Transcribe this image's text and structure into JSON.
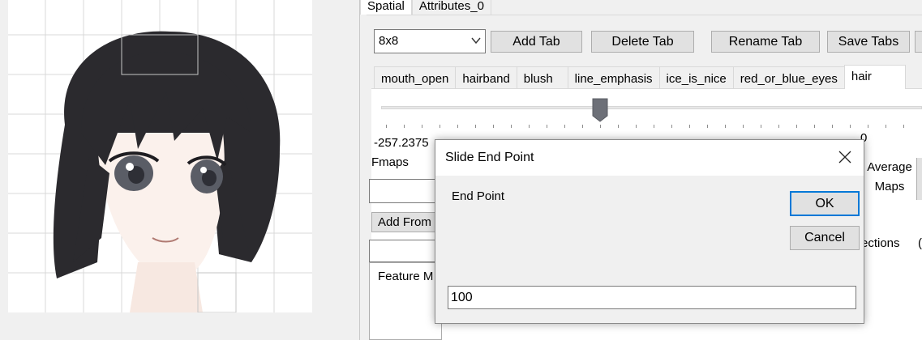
{
  "top_tabs": [
    {
      "label": "Spatial"
    },
    {
      "label": "Attributes_0"
    }
  ],
  "toolbar": {
    "grid_select_value": "8x8",
    "add_tab": "Add Tab",
    "delete_tab": "Delete Tab",
    "rename_tab": "Rename Tab",
    "save_tabs": "Save Tabs"
  },
  "feature_tabs": [
    {
      "label": "mouth_open"
    },
    {
      "label": "hairband"
    },
    {
      "label": "blush"
    },
    {
      "label": "line_emphasis"
    },
    {
      "label": "ice_is_nice"
    },
    {
      "label": "red_or_blue_eyes"
    },
    {
      "label": "hair"
    }
  ],
  "slider": {
    "min_label": "-257.2375",
    "max_label_partial": "0",
    "position_fraction": 0.4
  },
  "panel": {
    "fmaps_label": "Fmaps",
    "add_from_label": "Add From",
    "feature_header": "Feature M",
    "average_maps_line1": "Average",
    "average_maps_line2": "Maps",
    "directions_label": "ections",
    "directions_paren": "("
  },
  "dialog": {
    "title": "Slide End Point",
    "label": "End Point",
    "ok": "OK",
    "cancel": "Cancel",
    "input_value": "100"
  },
  "colors": {
    "accent": "#0078d7",
    "hair": "#2b2a2e",
    "eyes": "#5a5d66",
    "skin": "#fbf1ec"
  }
}
